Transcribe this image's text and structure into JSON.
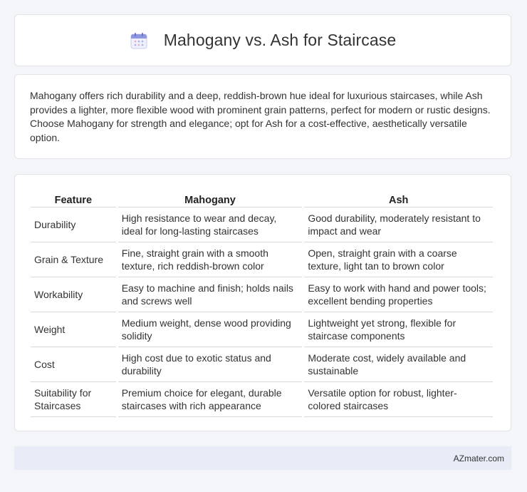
{
  "header": {
    "title": "Mahogany vs. Ash for Staircase",
    "icon": "calendar-icon"
  },
  "summary": {
    "text": "Mahogany offers rich durability and a deep, reddish-brown hue ideal for luxurious staircases, while Ash provides a lighter, more flexible wood with prominent grain patterns, perfect for modern or rustic designs. Choose Mahogany for strength and elegance; opt for Ash for a cost-effective, aesthetically versatile option."
  },
  "table": {
    "headers": [
      "Feature",
      "Mahogany",
      "Ash"
    ],
    "rows": [
      [
        "Durability",
        "High resistance to wear and decay, ideal for long-lasting staircases",
        "Good durability, moderately resistant to impact and wear"
      ],
      [
        "Grain & Texture",
        "Fine, straight grain with a smooth texture, rich reddish-brown color",
        "Open, straight grain with a coarse texture, light tan to brown color"
      ],
      [
        "Workability",
        "Easy to machine and finish; holds nails and screws well",
        "Easy to work with hand and power tools; excellent bending properties"
      ],
      [
        "Weight",
        "Medium weight, dense wood providing solidity",
        "Lightweight yet strong, flexible for staircase components"
      ],
      [
        "Cost",
        "High cost due to exotic status and durability",
        "Moderate cost, widely available and sustainable"
      ],
      [
        "Suitability for Staircases",
        "Premium choice for elegant, durable staircases with rich appearance",
        "Versatile option for robust, lighter-colored staircases"
      ]
    ]
  },
  "footer": {
    "brand": "AZmater.com"
  }
}
